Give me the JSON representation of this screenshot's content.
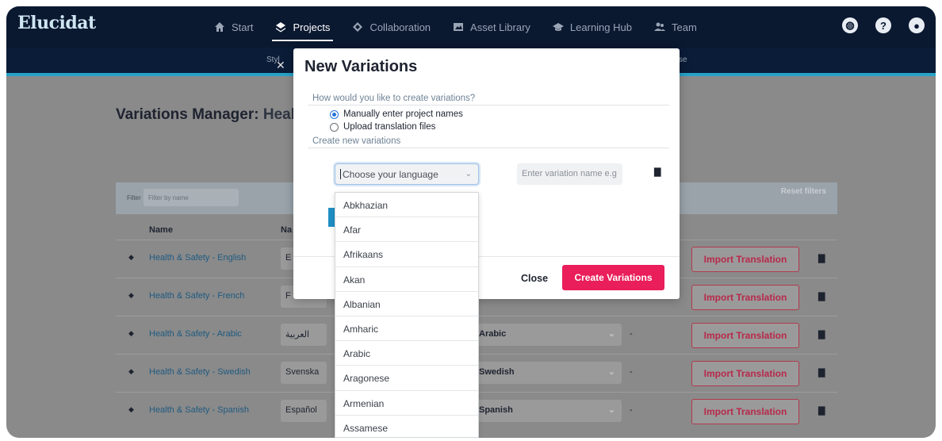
{
  "app": {
    "logo": "Elucidat"
  },
  "nav": {
    "items": [
      {
        "label": "Start",
        "icon": "home-icon"
      },
      {
        "label": "Projects",
        "icon": "layers-icon",
        "active": true
      },
      {
        "label": "Collaboration",
        "icon": "diamond-icon"
      },
      {
        "label": "Asset Library",
        "icon": "image-icon"
      },
      {
        "label": "Learning Hub",
        "icon": "graduation-cap-icon"
      },
      {
        "label": "Team",
        "icon": "users-icon"
      }
    ],
    "right_icons": [
      "globe-icon",
      "help-icon",
      "user-icon"
    ]
  },
  "subnav": {
    "left_text": "Styl",
    "right_text": "se"
  },
  "page": {
    "title_prefix": "Variations Manager:",
    "title_rest": "Heal"
  },
  "filter": {
    "label": "Filter",
    "placeholder": "Filter by name",
    "reset": "Reset filters"
  },
  "table": {
    "headers": {
      "name": "Name",
      "native": "Na"
    },
    "rows": [
      {
        "name": "Health & Safety - English",
        "native": "E",
        "language": "",
        "dash": "",
        "import": "Import Translation"
      },
      {
        "name": "Health & Safety - French",
        "native": "F",
        "language": "",
        "dash": "",
        "import": "Import Translation"
      },
      {
        "name": "Health & Safety - Arabic",
        "native": "العربية",
        "language": "Arabic",
        "dash": "-",
        "import": "Import Translation"
      },
      {
        "name": "Health & Safety - Swedish",
        "native": "Svenska",
        "language": "Swedish",
        "dash": "-",
        "import": "Import Translation"
      },
      {
        "name": "Health & Safety - Spanish",
        "native": "Español",
        "language": "Spanish",
        "dash": "-",
        "import": "Import Translation"
      }
    ]
  },
  "modal": {
    "title": "New Variations",
    "question": "How would you like to create variations?",
    "options": [
      {
        "label": "Manually enter project names",
        "selected": true
      },
      {
        "label": "Upload translation files",
        "selected": false
      }
    ],
    "create_section": "Create new variations",
    "language_placeholder": "Choose your language",
    "variation_placeholder": "Enter variation name e.g",
    "close": "Close",
    "create": "Create Variations"
  },
  "dropdown": {
    "options": [
      "Abkhazian",
      "Afar",
      "Afrikaans",
      "Akan",
      "Albanian",
      "Amharic",
      "Arabic",
      "Aragonese",
      "Armenian",
      "Assamese"
    ]
  },
  "colors": {
    "primary": "#e91e5a",
    "nav_bg": "#0a1830",
    "accent": "#27a2c8",
    "link": "#1f5a80"
  }
}
